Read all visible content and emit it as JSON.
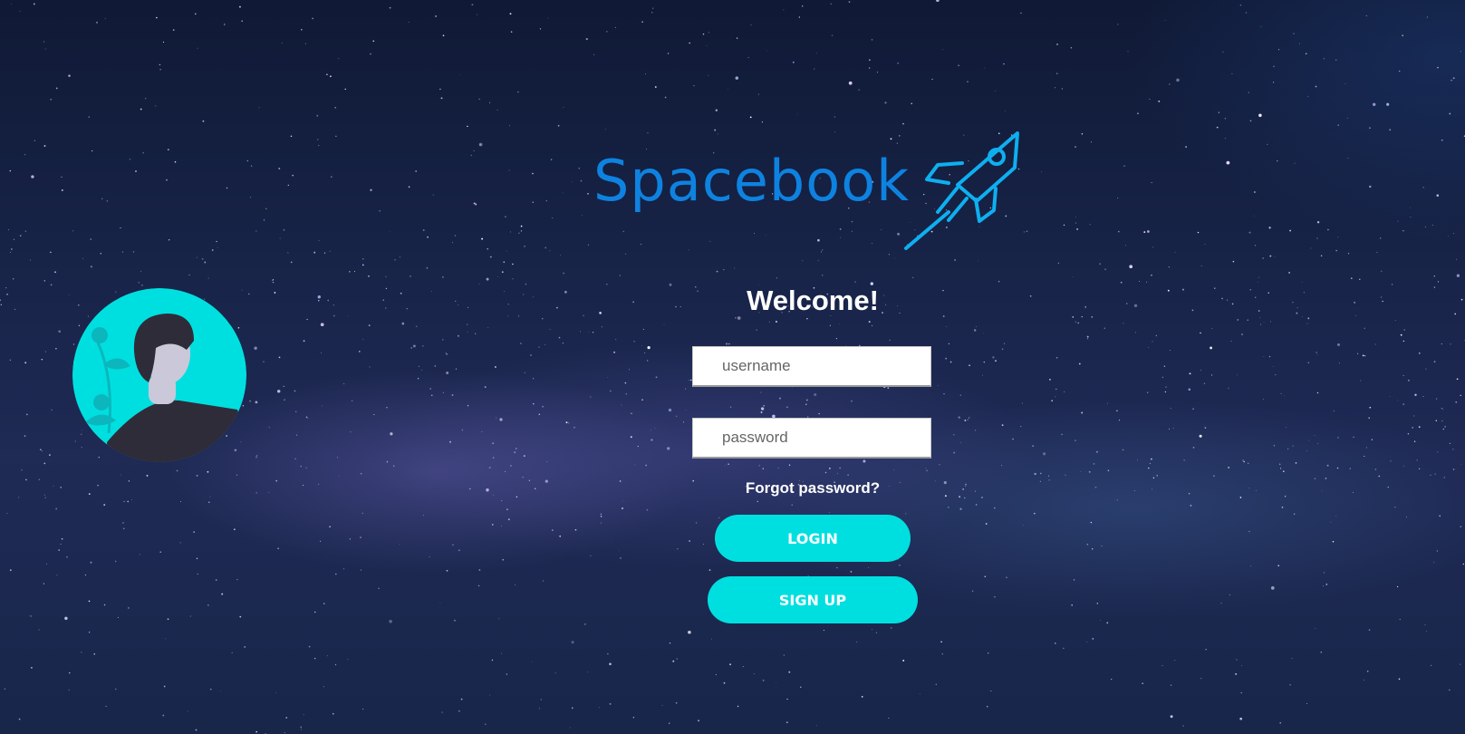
{
  "logo": {
    "text": "Spacebook",
    "icon": "rocket-icon",
    "color": "#0e82e0"
  },
  "avatar": {
    "icon": "user-avatar-icon",
    "background_color": "#00dfe0"
  },
  "login": {
    "title": "Welcome!",
    "username_placeholder": "username",
    "password_placeholder": "password",
    "forgot_label": "Forgot password?",
    "login_label": "LOGIN",
    "signup_label": "SIGN UP",
    "button_color": "#00dfe0"
  }
}
